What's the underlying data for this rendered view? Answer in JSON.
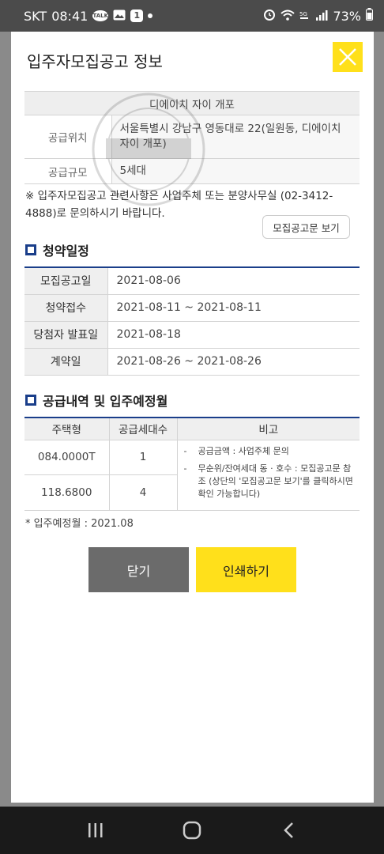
{
  "status_bar": {
    "carrier": "SKT",
    "time": "08:41",
    "notif_count": "1",
    "talk_badge": "TALK",
    "battery": "73%"
  },
  "modal": {
    "title": "입주자모집공고 정보",
    "info": {
      "name": "디에이치 자이 개포",
      "rows": [
        {
          "label": "공급위치",
          "value": "서울특별시 강남구 영동대로 22(일원동, 디에이치 자이 개포)"
        },
        {
          "label": "공급규모",
          "value": "5세대"
        }
      ]
    },
    "notice": "※ 입주자모집공고 관련사항은 사업주체 또는 분양사무실 (02-3412-4888)로 문의하시기 바랍니다.",
    "notice_button": "모집공고문 보기",
    "schedule_title": "청약일정",
    "schedule": [
      {
        "label": "모집공고일",
        "value": "2021-08-06"
      },
      {
        "label": "청약접수",
        "value": "2021-08-11 ~ 2021-08-11"
      },
      {
        "label": "당첨자 발표일",
        "value": "2021-08-18"
      },
      {
        "label": "계약일",
        "value": "2021-08-26 ~ 2021-08-26"
      }
    ],
    "supply_title": "공급내역 및 입주예정월",
    "supply_headers": [
      "주택형",
      "공급세대수",
      "비고"
    ],
    "supply_rows": [
      {
        "type": "084.0000T",
        "units": "1"
      },
      {
        "type": "118.6800",
        "units": "4"
      }
    ],
    "supply_notes": [
      "공급금액 : 사업주체 문의",
      "무순위/잔여세대 동 · 호수 : 모집공고문 참조 (상단의 '모집공고문 보기'를 클릭하시면 확인 가능합니다)"
    ],
    "movein": "* 입주예정월 : 2021.08",
    "close_button": "닫기",
    "print_button": "인쇄하기"
  },
  "colors": {
    "accent_yellow": "#ffe01b",
    "navy": "#1a3e8a",
    "dark_button": "#6b6b6b"
  }
}
